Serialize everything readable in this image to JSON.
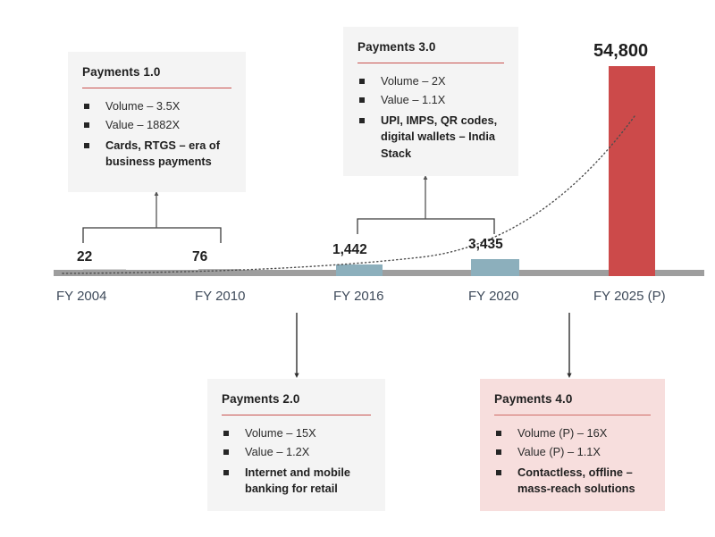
{
  "chart_data": {
    "type": "bar",
    "title": "",
    "xlabel": "",
    "ylabel": "",
    "categories": [
      "FY 2004",
      "FY 2010",
      "FY 2016",
      "FY 2020",
      "FY 2025 (P)"
    ],
    "values": [
      22,
      76,
      1442,
      3435,
      54800
    ],
    "value_labels": [
      "22",
      "76",
      "1,442",
      "3,435",
      "54,800"
    ],
    "ylim": [
      0,
      54800
    ],
    "grid": false,
    "legend": "none",
    "bar_colors": [
      "#9e9e9e",
      "#9e9e9e",
      "#8cafbc",
      "#8cafbc",
      "#cc4a4a"
    ],
    "overlay_trend": {
      "style": "dotted",
      "color": "#4d4d4d",
      "description": "exponential growth trend curve rising from baseline to FY 2025"
    },
    "annotations": [
      {
        "label": "Payments 1.0",
        "spans": [
          "FY 2004",
          "FY 2010"
        ]
      },
      {
        "label": "Payments 2.0",
        "spans": [
          "FY 2016"
        ]
      },
      {
        "label": "Payments 3.0",
        "spans": [
          "FY 2016",
          "FY 2020"
        ]
      },
      {
        "label": "Payments 4.0",
        "spans": [
          "FY 2025 (P)"
        ]
      }
    ]
  },
  "axis": {
    "ticks": [
      {
        "label": "FY 2004"
      },
      {
        "label": "FY 2010"
      },
      {
        "label": "FY 2016"
      },
      {
        "label": "FY 2020"
      },
      {
        "label": "FY 2025 (P)"
      }
    ]
  },
  "bar_values": [
    {
      "label": "22"
    },
    {
      "label": "76"
    },
    {
      "label": "1,442"
    },
    {
      "label": "3,435"
    },
    {
      "label": "54,800"
    }
  ],
  "callouts": [
    {
      "id": "payments-1",
      "title": "Payments 1.0",
      "bullets": [
        {
          "text": "Volume – 3.5X",
          "bold": false
        },
        {
          "text": "Value – 1882X",
          "bold": false
        },
        {
          "text": "Cards, RTGS – era of business payments",
          "bold": true
        }
      ]
    },
    {
      "id": "payments-2",
      "title": "Payments 2.0",
      "bullets": [
        {
          "text": "Volume – 15X",
          "bold": false
        },
        {
          "text": "Value – 1.2X",
          "bold": false
        },
        {
          "text": "Internet and mobile banking for retail",
          "bold": true
        }
      ]
    },
    {
      "id": "payments-3",
      "title": "Payments 3.0",
      "bullets": [
        {
          "text": "Volume – 2X",
          "bold": false
        },
        {
          "text": "Value – 1.1X",
          "bold": false
        },
        {
          "text": "UPI, IMPS, QR codes, digital wallets – India Stack",
          "bold": true
        }
      ]
    },
    {
      "id": "payments-4",
      "title": "Payments 4.0",
      "bullets": [
        {
          "text": "Volume (P) – 16X",
          "bold": false
        },
        {
          "text": "Value (P) – 1.1X",
          "bold": false
        },
        {
          "text": "Contactless, offline – mass-reach solutions",
          "bold": true
        }
      ]
    }
  ],
  "colors": {
    "accent_red": "#cc4a4a",
    "rule_red": "#c9514f",
    "teal_bar": "#8cafbc",
    "grey_bar": "#9e9e9e",
    "box_grey": "#f4f4f4",
    "box_pink": "#f7dedd",
    "axis_text": "#3e4a5a",
    "connector": "#4d4d4d"
  }
}
